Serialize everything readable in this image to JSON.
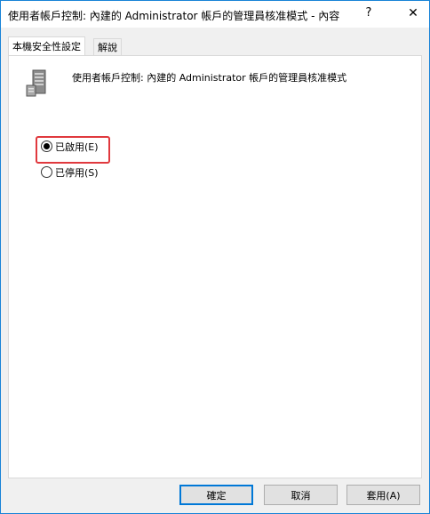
{
  "window": {
    "title": "使用者帳戶控制: 內建的 Administrator 帳戶的管理員核准模式 - 內容",
    "help": "?",
    "close": "✕"
  },
  "tabs": [
    {
      "label": "本機安全性設定",
      "active": true
    },
    {
      "label": "解說",
      "active": false
    }
  ],
  "policy": {
    "description": "使用者帳戶控制: 內建的 Administrator 帳戶的管理員核准模式"
  },
  "options": [
    {
      "label": "已啟用(E)",
      "selected": true
    },
    {
      "label": "已停用(S)",
      "selected": false
    }
  ],
  "buttons": {
    "ok": "確定",
    "cancel": "取消",
    "apply": "套用(A)"
  },
  "icons": {
    "server": "server-icon"
  },
  "colors": {
    "highlight": "#e0393e",
    "accent": "#0078d7"
  }
}
